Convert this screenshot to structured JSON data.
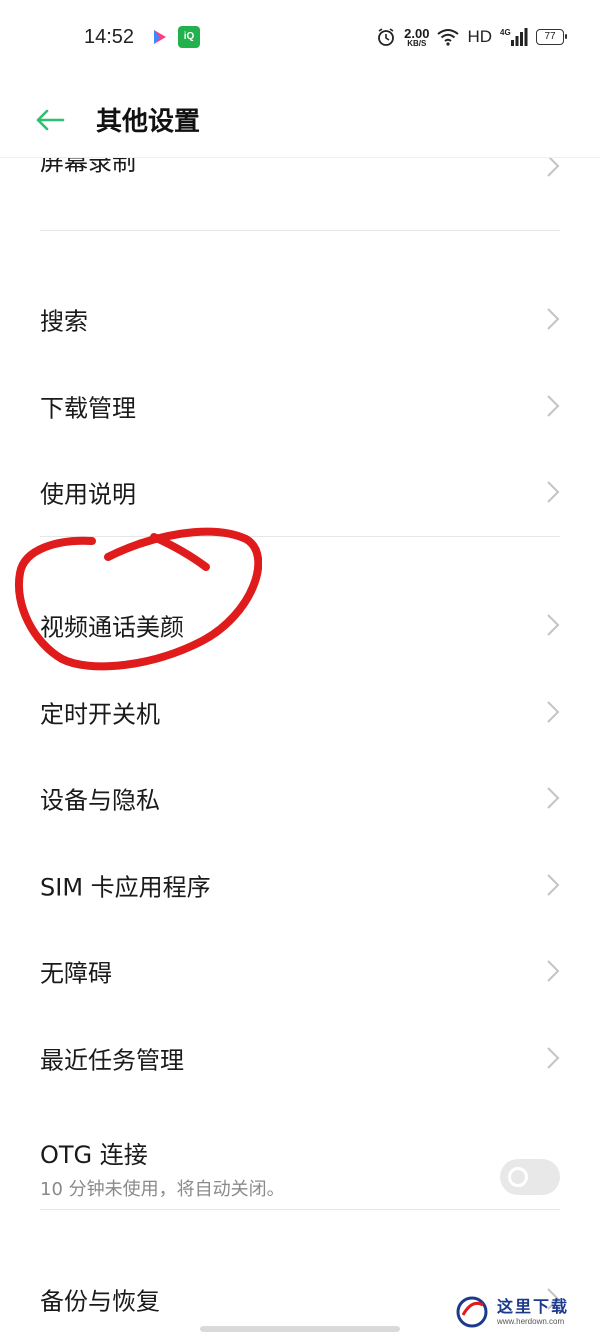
{
  "status_bar": {
    "time": "14:52",
    "net_speed_value": "2.00",
    "net_speed_unit": "KB/S",
    "hd_label": "HD",
    "battery": "77",
    "app2_label": "iQIYI"
  },
  "header": {
    "title": "其他设置",
    "accent_color": "#2fbf71"
  },
  "list": {
    "partial_item": "屏幕录制",
    "group1": [
      "搜索",
      "下载管理",
      "使用说明"
    ],
    "group2": [
      "视频通话美颜",
      "定时开关机",
      "设备与隐私",
      "SIM 卡应用程序",
      "无障碍",
      "最近任务管理"
    ],
    "otg": {
      "label": "OTG 连接",
      "sub": "10 分钟未使用，将自动关闭。",
      "enabled": false
    },
    "group3": [
      "备份与恢复"
    ]
  },
  "annotation": {
    "color": "#e01b1b",
    "target": "视频通话美颜"
  },
  "watermark": {
    "text": "这里下载",
    "url": "www.herdown.com"
  }
}
